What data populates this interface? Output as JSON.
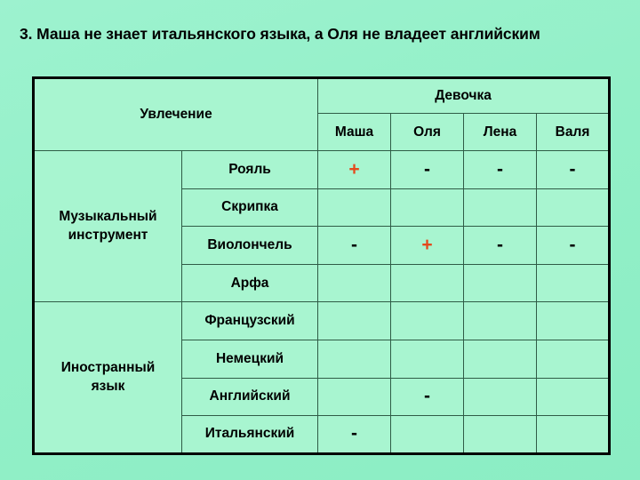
{
  "title": "3. Маша не знает итальянского языка, а Оля не владеет английским",
  "colors": {
    "page_background": "#93f0c8",
    "cell_background": "#a8f5d0",
    "outer_border": "#000000",
    "inner_border": "#2f5c46",
    "plus_mark": "#e4491c",
    "minus_mark": "#000000",
    "text": "#000000"
  },
  "table": {
    "corner_header": "Увлечение",
    "group_header": "Девочка",
    "girls": [
      "Маша",
      "Оля",
      "Лена",
      "Валя"
    ],
    "categories": [
      {
        "label": "Музыкальный инструмент",
        "label_line1": "Музыкальный",
        "label_line2": "инструмент",
        "rows": [
          {
            "item": "Рояль",
            "marks": [
              "+",
              "-",
              "-",
              "-"
            ]
          },
          {
            "item": "Скрипка",
            "marks": [
              "",
              "",
              "",
              ""
            ]
          },
          {
            "item": "Виолончель",
            "marks": [
              "-",
              "+",
              "-",
              "-"
            ]
          },
          {
            "item": "Арфа",
            "marks": [
              "",
              "",
              "",
              ""
            ]
          }
        ]
      },
      {
        "label": "Иностранный язык",
        "label_line1": "Иностранный",
        "label_line2": "язык",
        "rows": [
          {
            "item": "Французский",
            "marks": [
              "",
              "",
              "",
              ""
            ]
          },
          {
            "item": "Немецкий",
            "marks": [
              "",
              "",
              "",
              ""
            ]
          },
          {
            "item": "Английский",
            "marks": [
              "",
              "-",
              "",
              ""
            ]
          },
          {
            "item": "Итальянский",
            "marks": [
              "-",
              "",
              "",
              ""
            ]
          }
        ]
      }
    ]
  }
}
